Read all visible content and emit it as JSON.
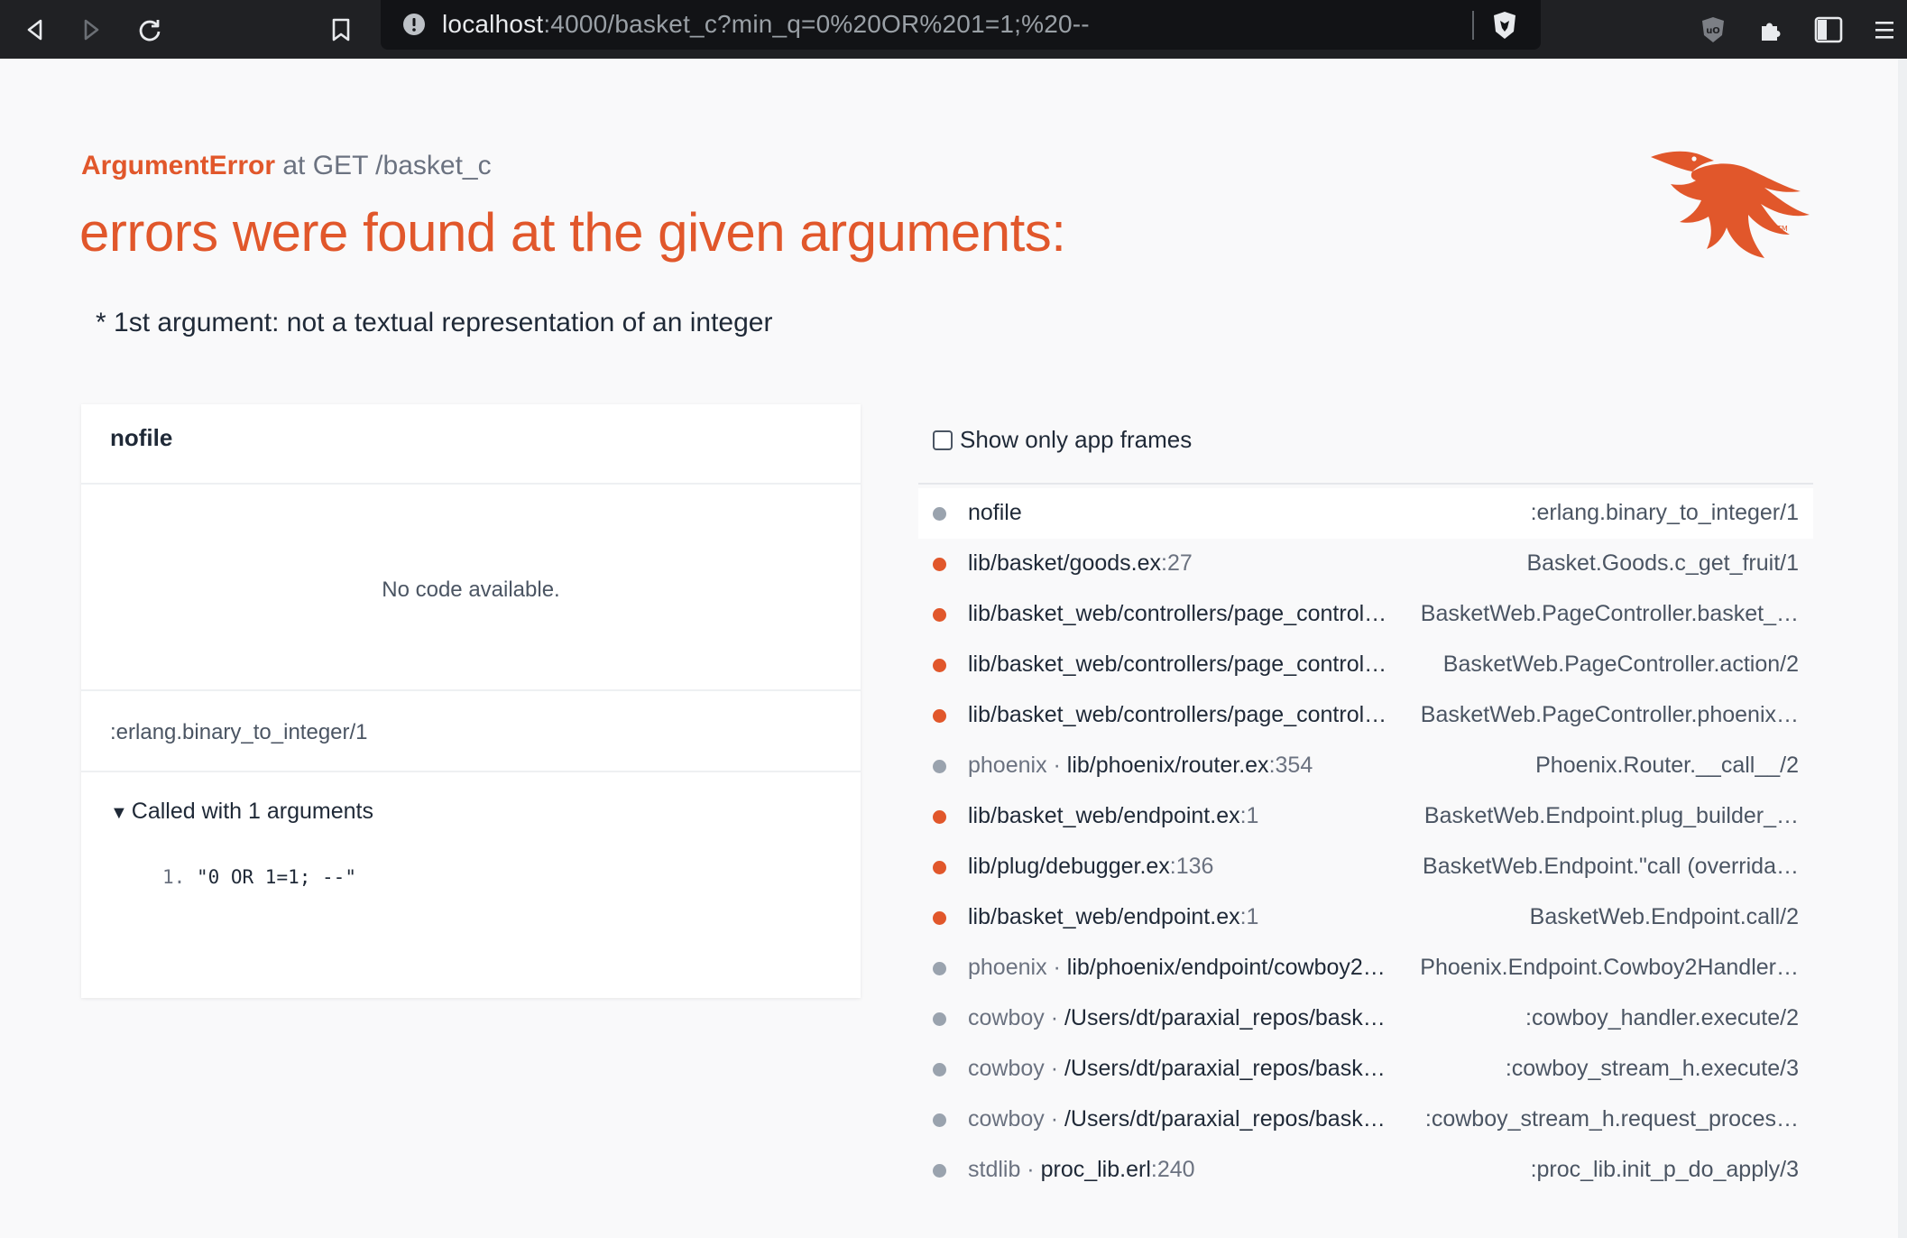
{
  "browser": {
    "url_host": "localhost",
    "url_rest": ":4000/basket_c?min_q=0%20OR%201=1;%20--",
    "icons": [
      "back-icon",
      "forward-icon",
      "reload-icon",
      "bookmark-icon",
      "site-info-icon",
      "brave-shield-icon",
      "ublock-icon",
      "extensions-icon",
      "sidebar-icon",
      "menu-icon"
    ]
  },
  "error": {
    "exception": "ArgumentError",
    "method_path": " at GET /basket_c",
    "title": "errors were found at the given arguments:",
    "detail": "* 1st argument: not a textual representation of an integer"
  },
  "code_panel": {
    "file": "nofile",
    "no_code": "No code available.",
    "mfa": ":erlang.binary_to_integer/1",
    "called_with": "Called with 1 arguments",
    "arg_index": "1.",
    "arg_value": "\"0 OR 1=1; --\""
  },
  "frames": {
    "show_only_label": "Show only app frames",
    "items": [
      {
        "app": false,
        "pkg": "",
        "file": "nofile",
        "line": "",
        "mfa": ":erlang.binary_to_integer/1",
        "active": true
      },
      {
        "app": true,
        "pkg": "",
        "file": "lib/basket/goods.ex",
        "line": ":27",
        "mfa": "Basket.Goods.c_get_fruit/1"
      },
      {
        "app": true,
        "pkg": "",
        "file": "lib/basket_web/controllers/page_control…",
        "line": "",
        "mfa": "BasketWeb.PageController.basket_…"
      },
      {
        "app": true,
        "pkg": "",
        "file": "lib/basket_web/controllers/page_control…",
        "line": "",
        "mfa": "BasketWeb.PageController.action/2"
      },
      {
        "app": true,
        "pkg": "",
        "file": "lib/basket_web/controllers/page_control…",
        "line": "",
        "mfa": "BasketWeb.PageController.phoenix…"
      },
      {
        "app": false,
        "pkg": "phoenix · ",
        "file": "lib/phoenix/router.ex",
        "line": ":354",
        "mfa": "Phoenix.Router.__call__/2"
      },
      {
        "app": true,
        "pkg": "",
        "file": "lib/basket_web/endpoint.ex",
        "line": ":1",
        "mfa": "BasketWeb.Endpoint.plug_builder_…"
      },
      {
        "app": true,
        "pkg": "",
        "file": "lib/plug/debugger.ex",
        "line": ":136",
        "mfa": "BasketWeb.Endpoint.\"call (overrida…"
      },
      {
        "app": true,
        "pkg": "",
        "file": "lib/basket_web/endpoint.ex",
        "line": ":1",
        "mfa": "BasketWeb.Endpoint.call/2"
      },
      {
        "app": false,
        "pkg": "phoenix · ",
        "file": "lib/phoenix/endpoint/cowboy2…",
        "line": "",
        "mfa": "Phoenix.Endpoint.Cowboy2Handler…"
      },
      {
        "app": false,
        "pkg": "cowboy · ",
        "file": "/Users/dt/paraxial_repos/bask…",
        "line": "",
        "mfa": ":cowboy_handler.execute/2"
      },
      {
        "app": false,
        "pkg": "cowboy · ",
        "file": "/Users/dt/paraxial_repos/bask…",
        "line": "",
        "mfa": ":cowboy_stream_h.execute/3"
      },
      {
        "app": false,
        "pkg": "cowboy · ",
        "file": "/Users/dt/paraxial_repos/bask…",
        "line": "",
        "mfa": ":cowboy_stream_h.request_proces…"
      },
      {
        "app": false,
        "pkg": "stdlib · ",
        "file": "proc_lib.erl",
        "line": ":240",
        "mfa": ":proc_lib.init_p_do_apply/3"
      }
    ]
  },
  "colors": {
    "accent": "#e1572b",
    "app_dot": "#e1572b",
    "lib_dot": "#9aa3ae"
  }
}
